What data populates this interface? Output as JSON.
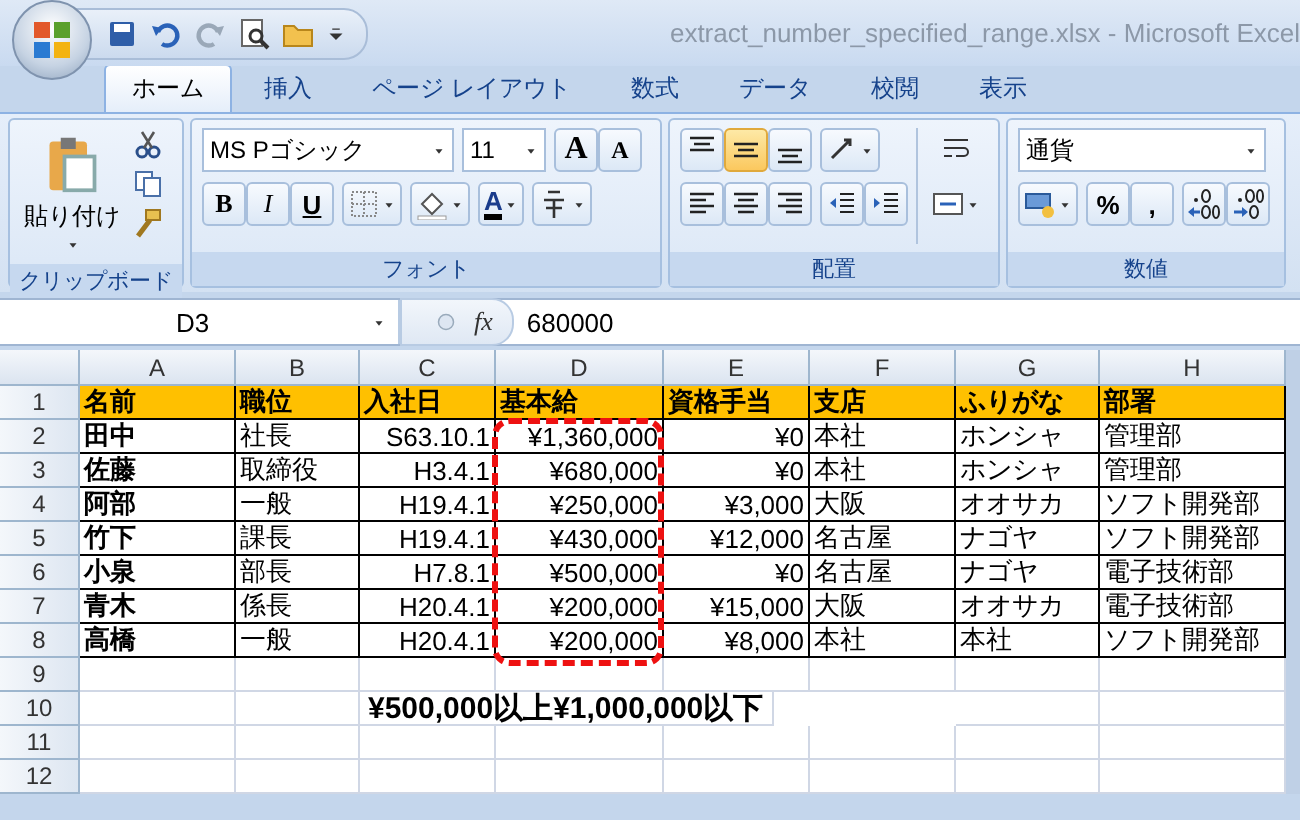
{
  "window": {
    "title": "extract_number_specified_range.xlsx - Microsoft Excel"
  },
  "tabs": [
    {
      "label": "ホーム",
      "selected": true
    },
    {
      "label": "挿入",
      "selected": false
    },
    {
      "label": "ページ レイアウト",
      "selected": false
    },
    {
      "label": "数式",
      "selected": false
    },
    {
      "label": "データ",
      "selected": false
    },
    {
      "label": "校閲",
      "selected": false
    },
    {
      "label": "表示",
      "selected": false
    }
  ],
  "ribbon": {
    "clipboard": {
      "label": "クリップボード",
      "paste_label": "貼り付け"
    },
    "font": {
      "label": "フォント",
      "font_name": "MS Pゴシック",
      "font_size": "11",
      "size_buttons": [
        "A",
        "A"
      ],
      "style_buttons": [
        "B",
        "I",
        "U"
      ],
      "font_color_button": "A"
    },
    "alignment": {
      "label": "配置",
      "vertical_buttons": [
        {
          "kind": "top",
          "selected": false
        },
        {
          "kind": "middle",
          "selected": true
        },
        {
          "kind": "bottom",
          "selected": false
        }
      ]
    },
    "number": {
      "label": "数値",
      "format": "通貨",
      "buttons": [
        "%",
        ","
      ]
    }
  },
  "formula_bar": {
    "name_box": "D3",
    "function_label": "fx",
    "formula": "680000"
  },
  "sheet": {
    "columns": [
      "A",
      "B",
      "C",
      "D",
      "E",
      "F",
      "G",
      "H"
    ],
    "row_numbers": [
      "1",
      "2",
      "3",
      "4",
      "5",
      "6",
      "7",
      "8",
      "9",
      "10",
      "11",
      "12"
    ],
    "header": [
      "名前",
      "職位",
      "入社日",
      "基本給",
      "資格手当",
      "支店",
      "ふりがな",
      "部署"
    ],
    "rows": [
      [
        "田中",
        "社長",
        "S63.10.1",
        "¥1,360,000",
        "¥0",
        "本社",
        "ホンシャ",
        "管理部"
      ],
      [
        "佐藤",
        "取締役",
        "H3.4.1",
        "¥680,000",
        "¥0",
        "本社",
        "ホンシャ",
        "管理部"
      ],
      [
        "阿部",
        "一般",
        "H19.4.1",
        "¥250,000",
        "¥3,000",
        "大阪",
        "オオサカ",
        "ソフト開発部"
      ],
      [
        "竹下",
        "課長",
        "H19.4.1",
        "¥430,000",
        "¥12,000",
        "名古屋",
        "ナゴヤ",
        "ソフト開発部"
      ],
      [
        "小泉",
        "部長",
        "H7.8.1",
        "¥500,000",
        "¥0",
        "名古屋",
        "ナゴヤ",
        "電子技術部"
      ],
      [
        "青木",
        "係長",
        "H20.4.1",
        "¥200,000",
        "¥15,000",
        "大阪",
        "オオサカ",
        "電子技術部"
      ],
      [
        "高橋",
        "一般",
        "H20.4.1",
        "¥200,000",
        "¥8,000",
        "本社",
        "本社",
        "ソフト開発部"
      ]
    ],
    "note": "¥500,000以上¥1,000,000以下"
  }
}
